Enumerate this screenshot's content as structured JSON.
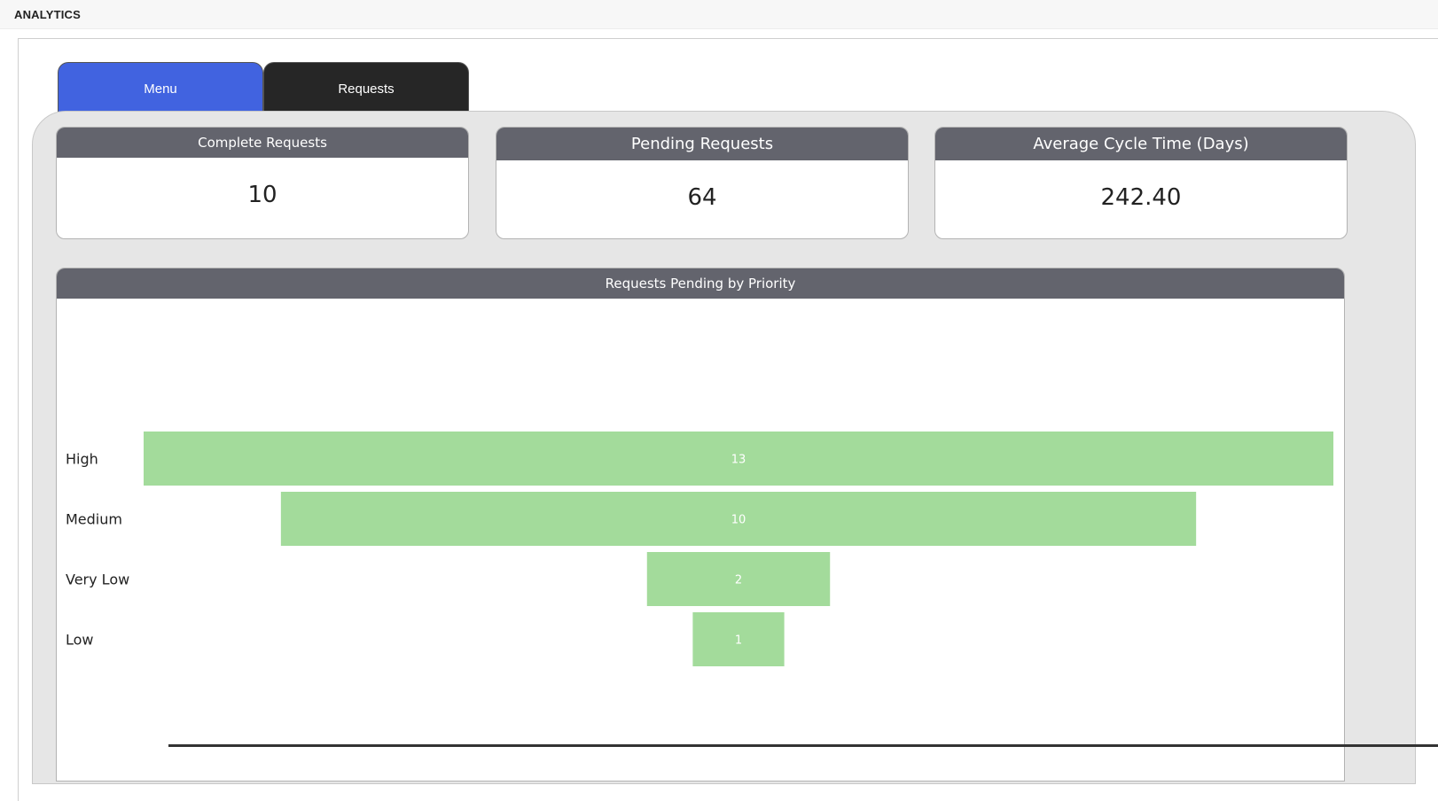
{
  "app": {
    "title": "ANALYTICS"
  },
  "tabs": [
    {
      "label": "Menu",
      "active": true,
      "color": "#4163e0"
    },
    {
      "label": "Requests",
      "active": false,
      "color": "#262626"
    }
  ],
  "cards": [
    {
      "title": "Complete Requests",
      "value": "10"
    },
    {
      "title": "Pending Requests",
      "value": "64"
    },
    {
      "title": "Average Cycle Time (Days)",
      "value": "242.40"
    }
  ],
  "chart": {
    "title": "Requests Pending by Priority"
  },
  "chart_data": {
    "type": "bar",
    "subtype": "funnel",
    "title": "Requests Pending by Priority",
    "categories": [
      "High",
      "Medium",
      "Very Low",
      "Low"
    ],
    "values": [
      13,
      10,
      2,
      1
    ],
    "bar_color": "#a3db9b",
    "label_color": "#ffffff"
  },
  "colors": {
    "header_gray": "#63646d",
    "panel_bg": "#e6e6e6",
    "accent_blue": "#4163e0"
  }
}
